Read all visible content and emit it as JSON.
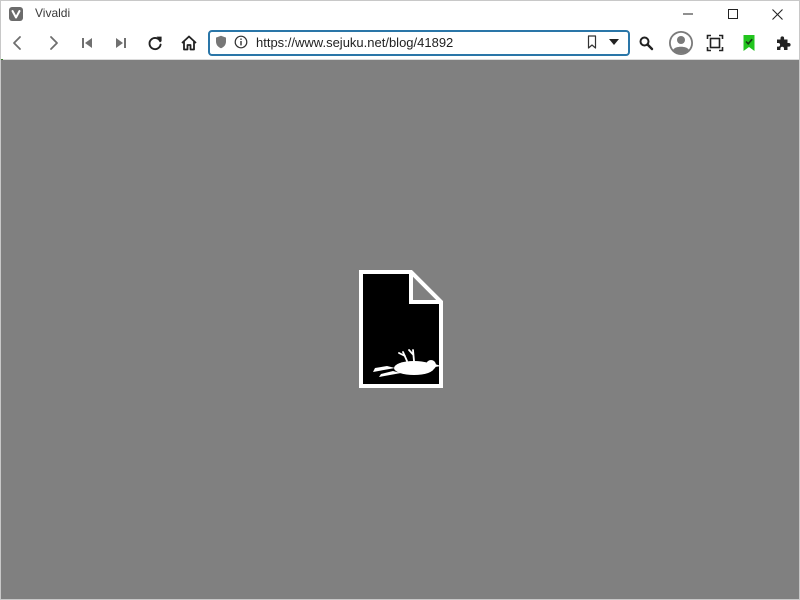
{
  "window": {
    "title": "Vivaldi"
  },
  "address_bar": {
    "url": "https://www.sejuku.net/blog/41892"
  },
  "colors": {
    "address_border": "#2a76a8",
    "viewport_background": "#808080",
    "reading_list_accent": "#22c51e"
  },
  "icons": {
    "app": "vivaldi-logo-icon",
    "back": "back-arrow-icon",
    "forward": "forward-arrow-icon",
    "rewind": "rewind-icon",
    "fast_forward": "fast-forward-icon",
    "reload": "reload-icon",
    "home": "home-icon",
    "shield": "shield-icon",
    "info": "info-icon",
    "bookmark": "bookmark-icon",
    "dropdown": "dropdown-arrow-icon",
    "search": "search-icon",
    "profile": "profile-avatar-icon",
    "capture": "capture-frame-icon",
    "reading_list": "reading-list-icon",
    "extensions": "puzzle-piece-icon",
    "broken_image": "broken-image-icon"
  }
}
